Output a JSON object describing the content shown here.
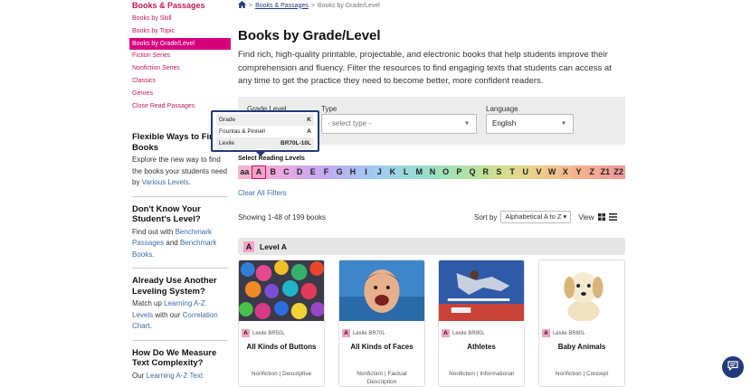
{
  "sidebar": {
    "title": "Books & Passages",
    "links": [
      "Books by Skill",
      "Books by Topic",
      "Books by Grade/Level",
      "Fiction Series",
      "Nonfiction Series",
      "Classics",
      "Genres",
      "Close Read Passages"
    ],
    "active_link": "Books by Grade/Level",
    "blocks": [
      {
        "heading": "Flexible Ways to Find Books",
        "text_before": "Explore the new way to find the books your students need by ",
        "link": "Various Levels",
        "text_after": "."
      },
      {
        "heading": "Don't Know Your Student's Level?",
        "text_before": "Find out with ",
        "link": "Benchmark Passages",
        "text_mid": " and ",
        "link2": "Benchmark Books",
        "text_after": "."
      },
      {
        "heading": "Already Use Another Leveling System?",
        "text_before": "Match up ",
        "link": "Learning A-Z Levels",
        "text_mid": " with our ",
        "link2": "Correlation Chart",
        "text_after": "."
      },
      {
        "heading": "How Do We Measure Text Complexity?",
        "text_before": "Our ",
        "link": "Learning A-Z Text",
        "text_after": ""
      }
    ]
  },
  "breadcrumb": {
    "home_icon": "home-icon",
    "parent": "Books & Passages",
    "current": "Books by Grade/Level",
    "separator": ">"
  },
  "page": {
    "title": "Books by Grade/Level",
    "intro": "Find rich, high-quality printable, projectable, and electronic books that help students improve their comprehension and fluency. Filter the resources to find engaging texts that students can access at any time to get the practice they need to become better, more confident readers."
  },
  "filters": {
    "grade_label": "Grade Level",
    "type_label": "Type",
    "type_placeholder": "- select type -",
    "language_label": "Language",
    "language_value": "English"
  },
  "tooltip": {
    "rows": [
      {
        "label": "Grade",
        "value": "K"
      },
      {
        "label": "Fountas & Pinnell",
        "value": "A"
      },
      {
        "label": "Lexile",
        "value": "BR70L-10L"
      }
    ]
  },
  "levels": {
    "label": "Select Reading Levels",
    "items": [
      "aa",
      "A",
      "B",
      "C",
      "D",
      "E",
      "F",
      "G",
      "H",
      "I",
      "J",
      "K",
      "L",
      "M",
      "N",
      "O",
      "P",
      "Q",
      "R",
      "S",
      "T",
      "U",
      "V",
      "W",
      "X",
      "Y",
      "Z",
      "Z1",
      "Z2"
    ],
    "colors": [
      "#f4b6cf",
      "#f5a3c7",
      "#f0aad8",
      "#e8a8e0",
      "#d9a9ea",
      "#cdaaf0",
      "#c2acf2",
      "#b8b4f3",
      "#aebcf3",
      "#a6c4f1",
      "#a0cced",
      "#9cd3e6",
      "#9ad8dc",
      "#99dbd0",
      "#9cdec4",
      "#a2e0b7",
      "#abe1aa",
      "#b6e19f",
      "#c2e096",
      "#cfde90",
      "#dcda8d",
      "#e6d48c",
      "#eecd8c",
      "#f2c48d",
      "#f4bb8f",
      "#f4b291",
      "#f3a993",
      "#f2a196",
      "#f09a99"
    ],
    "selected": "A",
    "clear_label": "Clear All Filters"
  },
  "results": {
    "showing": "Showing 1-48 of 199 books",
    "sort_label": "Sort by",
    "sort_value": "Alphabetical A to Z",
    "view_label": "View"
  },
  "level_section": {
    "badge": "A",
    "label": "Level A"
  },
  "cards": [
    {
      "badge": "A",
      "lexile": "Lexile BR50L",
      "title": "All Kinds of Buttons",
      "tags": "Nonfiction | Descriptive"
    },
    {
      "badge": "A",
      "lexile": "Lexile BR70L",
      "title": "All Kinds of Faces",
      "tags": "Nonfiction | Factual Description"
    },
    {
      "badge": "A",
      "lexile": "Lexile BR90L",
      "title": "Athletes",
      "tags": "Nonfiction | Informational"
    },
    {
      "badge": "A",
      "lexile": "Lexile BR80L",
      "title": "Baby Animals",
      "tags": "Nonfiction | Concept"
    }
  ]
}
